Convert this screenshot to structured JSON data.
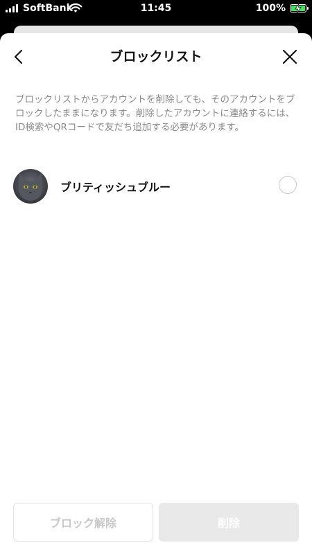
{
  "status_bar": {
    "carrier": "SoftBank",
    "time": "11:45",
    "battery_percent": "100%"
  },
  "header": {
    "title": "ブロックリスト",
    "back_icon": "chevron-left-icon",
    "close_icon": "close-icon"
  },
  "notice": "ブロックリストからアカウントを削除しても、そのアカウントをブロックしたままになります。削除したアカウントに連絡するには、ID検索やQRコードで友だち追加する必要があります。",
  "blocked_list": [
    {
      "name": "ブリティッシュブルー",
      "selected": false
    }
  ],
  "footer": {
    "unblock_label": "ブロック解除",
    "delete_label": "削除"
  },
  "colors": {
    "battery": "#4cd964",
    "notice_text": "#8a8a8a",
    "disabled_button_bg": "#e9e9e9"
  }
}
